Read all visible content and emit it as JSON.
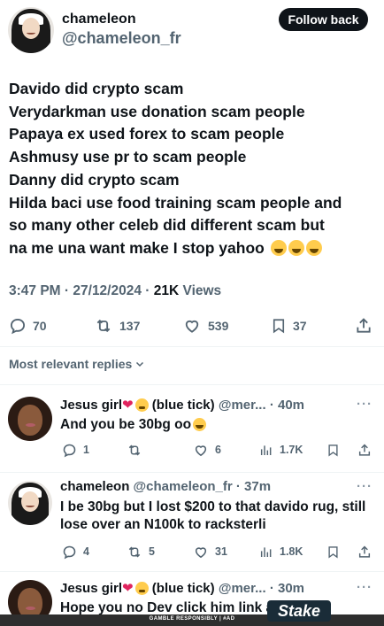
{
  "tweet": {
    "display_name": "chameleon",
    "handle": "@chameleon_fr",
    "follow_button": "Follow back",
    "lines": [
      "Davido did crypto scam",
      "Verydarkman use donation scam people",
      "Papaya ex used  forex to scam people",
      "Ashmusy use pr to scam people",
      "Danny did crypto scam",
      "Hilda baci use food training scam people and",
      "so many other celeb did different scam  but",
      "na me una want make I stop yahoo"
    ],
    "time": "3:47 PM",
    "date": "27/12/2024",
    "views_count": "21K",
    "views_label": "Views",
    "separator": "·",
    "stats": {
      "replies": "70",
      "reposts": "137",
      "likes": "539",
      "bookmarks": "37"
    }
  },
  "replies_filter": "Most relevant replies",
  "replies": [
    {
      "name": "Jesus girl",
      "badge": "(blue tick)",
      "handle": "@mer...",
      "time": "· 40m",
      "text": "And you be 30bg oo",
      "stats": {
        "replies": "1",
        "reposts": "",
        "likes": "6",
        "views": "1.7K"
      }
    },
    {
      "name": "chameleon",
      "handle": "@chameleon_fr",
      "time": "· 37m",
      "text": "I be 30bg but I lost $200 to that davido rug, still lose over an N100k to racksterli",
      "stats": {
        "replies": "4",
        "reposts": "5",
        "likes": "31",
        "views": "1.8K"
      }
    },
    {
      "name": "Jesus girl",
      "badge": "(blue tick)",
      "handle": "@mer...",
      "time": "· 30m",
      "text": "Hope you no Dev click him link again ?"
    }
  ],
  "more_glyph": "···",
  "ad": {
    "logo": "Stake",
    "disclaimer": "GAMBLE RESPONSIBLY | #AD"
  },
  "colors": {
    "text": "#0f1419",
    "secondary": "#536471",
    "heart": "#e0245e",
    "follow_bg": "#0f1419"
  }
}
